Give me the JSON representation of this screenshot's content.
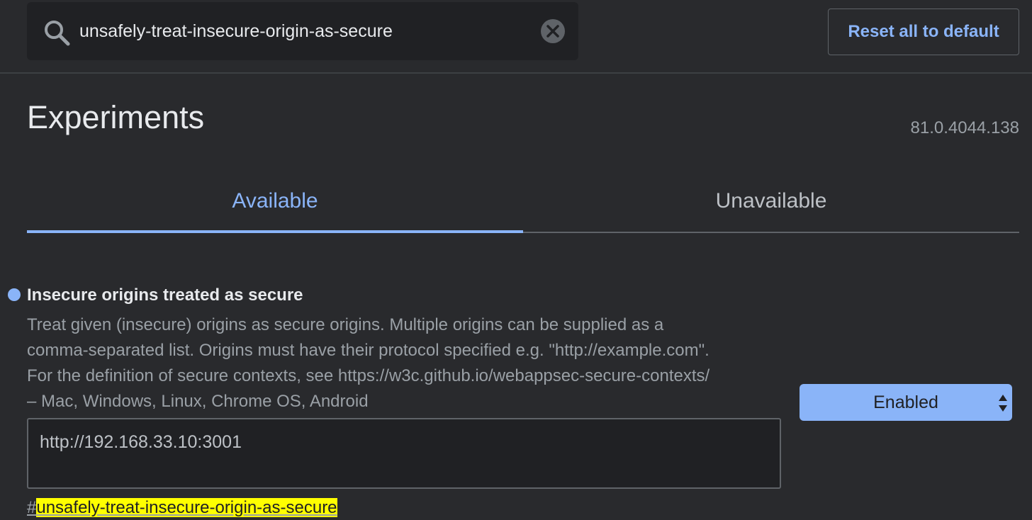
{
  "search": {
    "value": "unsafely-treat-insecure-origin-as-secure"
  },
  "header": {
    "reset_label": "Reset all to default"
  },
  "page": {
    "title": "Experiments",
    "version": "81.0.4044.138"
  },
  "tabs": [
    {
      "label": "Available",
      "active": true
    },
    {
      "label": "Unavailable",
      "active": false
    }
  ],
  "experiment": {
    "title": "Insecure origins treated as secure",
    "description_lines": [
      "Treat given (insecure) origins as secure origins. Multiple origins can be supplied as a",
      "comma-separated list. Origins must have their protocol specified e.g. \"http://example.com\".",
      "For the definition of secure contexts, see https://w3c.github.io/webappsec-secure-contexts/",
      "– Mac, Windows, Linux, Chrome OS, Android"
    ],
    "input_value": "http://192.168.33.10:3001",
    "select_value": "Enabled",
    "link_prefix": "#",
    "link_highlight": "unsafely-treat-insecure-origin-as-secure"
  },
  "colors": {
    "background": "#292a2d",
    "accent": "#8ab4f8",
    "highlight": "#ffff00"
  }
}
